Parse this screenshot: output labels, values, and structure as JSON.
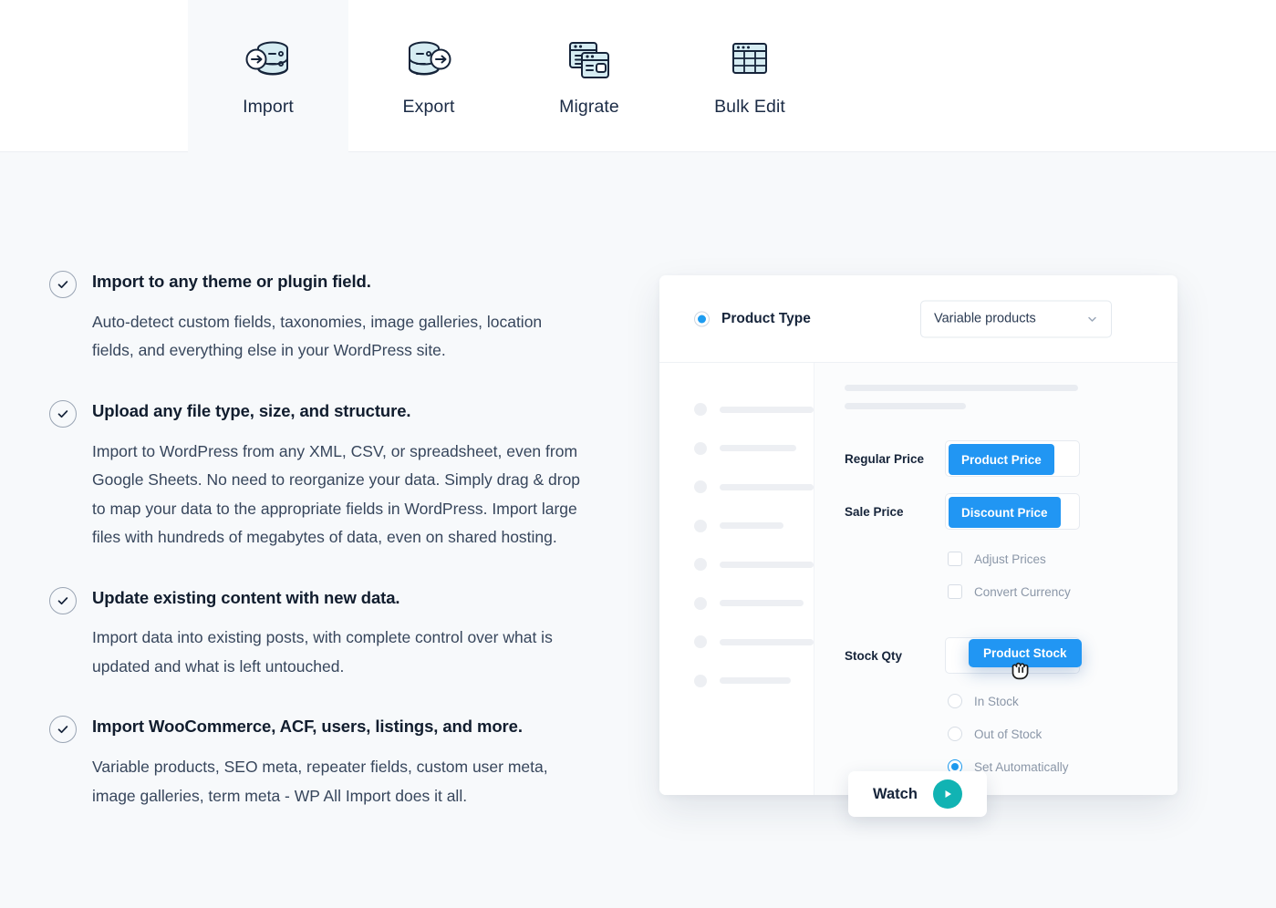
{
  "tabs": [
    {
      "id": "import",
      "label": "Import",
      "icon": "database-import-icon",
      "active": true
    },
    {
      "id": "export",
      "label": "Export",
      "icon": "database-export-icon",
      "active": false
    },
    {
      "id": "migrate",
      "label": "Migrate",
      "icon": "windows-migrate-icon",
      "active": false
    },
    {
      "id": "bulk-edit",
      "label": "Bulk Edit",
      "icon": "table-grid-icon",
      "active": false
    }
  ],
  "features": [
    {
      "title": "Import to any theme or plugin field.",
      "body": "Auto-detect custom fields, taxonomies, image galleries, location fields, and everything else in your WordPress site."
    },
    {
      "title": "Upload any file type, size, and structure.",
      "body": "Import to WordPress from any XML, CSV, or spreadsheet, even from Google Sheets. No need to reorganize your data. Simply drag & drop to map your data to the appropriate fields in WordPress. Import large files with hundreds of megabytes of data, even on shared hosting."
    },
    {
      "title": "Update existing content with new data.",
      "body": "Import data into existing posts, with complete control over what is updated and what is left untouched."
    },
    {
      "title": "Import WooCommerce, ACF, users, listings, and more.",
      "body": "Variable products, SEO meta, repeater fields, custom user meta, image galleries, term meta - WP All Import does it all."
    }
  ],
  "mockup": {
    "header": {
      "radio_label": "Product Type",
      "select_value": "Variable products",
      "chevron_icon": "chevron-down-icon"
    },
    "sidebar_skeleton_widths": [
      120,
      84,
      122,
      70,
      108,
      92,
      118,
      78
    ],
    "fields": [
      {
        "label": "Regular Price",
        "chip": "Product Price"
      },
      {
        "label": "Sale Price",
        "chip": "Discount Price"
      }
    ],
    "checkboxes": [
      {
        "label": "Adjust Prices",
        "checked": false
      },
      {
        "label": "Convert Currency",
        "checked": false
      }
    ],
    "stock": {
      "label": "Stock Qty",
      "dragging_chip": "Product Stock",
      "cursor_icon": "grabbing-hand-cursor"
    },
    "radios": [
      {
        "label": "In Stock",
        "selected": false
      },
      {
        "label": "Out of Stock",
        "selected": false
      },
      {
        "label": "Set Automatically",
        "selected": true
      }
    ]
  },
  "watch": {
    "label": "Watch",
    "icon": "play-circle-icon"
  },
  "colors": {
    "page_bg": "#f7f9fb",
    "chip_blue": "#2196f3",
    "radio_blue": "#1e9cf0",
    "play_teal": "#11b3b3",
    "icon_fill": "#d6ecf2",
    "icon_stroke": "#16243a",
    "heading": "#111d2e",
    "body_text": "#37465c",
    "muted_text": "#8b97a8"
  }
}
